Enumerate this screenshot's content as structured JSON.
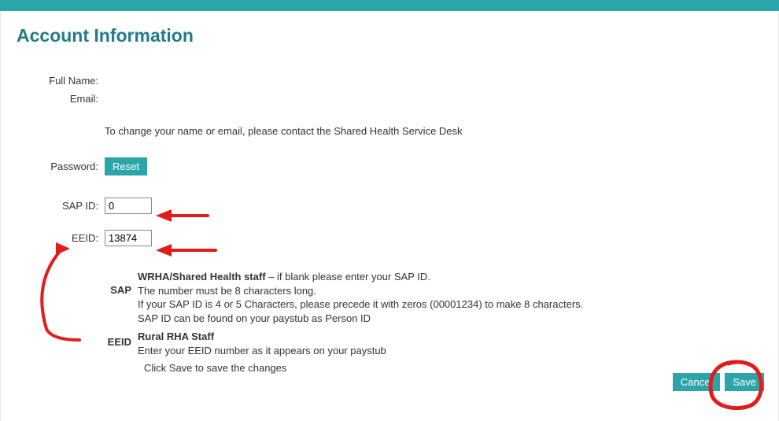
{
  "page_title": "Account Information",
  "fields": {
    "full_name_label": "Full Name:",
    "full_name_value": "",
    "email_label": "Email:",
    "email_value": "",
    "contact_note": "To change your name or email, please contact the Shared Health Service Desk",
    "password_label": "Password:",
    "reset_button": "Reset",
    "sap_id_label": "SAP ID:",
    "sap_id_value": "0",
    "eeid_label": "EEID:",
    "eeid_value": "13874"
  },
  "help": {
    "sap_key": "SAP",
    "sap_title": "WRHA/Shared Health staff",
    "sap_line1": " – if blank please enter your SAP ID.",
    "sap_line2": "The number must be 8 characters long.",
    "sap_line3": "If your SAP ID is 4 or 5 Characters, please precede it with zeros (00001234) to make 8 characters.",
    "sap_line4": "SAP ID can be found on your paystub as Person ID",
    "eeid_key": "EEID",
    "eeid_title": "Rural RHA Staff",
    "eeid_line1": "Enter your EEID number as it appears on your paystub",
    "save_note_prefix": "Click ",
    "save_note_bold": "Save",
    "save_note_suffix": " to save the changes"
  },
  "buttons": {
    "cancel": "Cancel",
    "save": "Save"
  }
}
